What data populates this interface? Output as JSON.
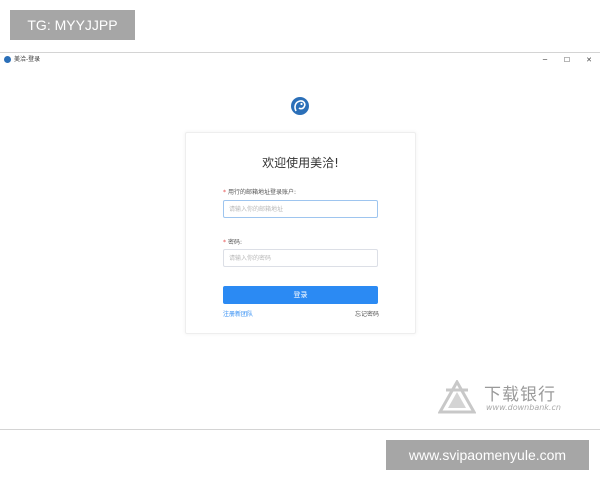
{
  "watermarks": {
    "top_text": "TG: MYYJJPP",
    "bottom_text": "www.svipaomenyule.com",
    "logo_text": "下载银行",
    "logo_url": "www.downbank.cn"
  },
  "window": {
    "title": "美洽-登录",
    "minimize_glyph": "─",
    "maximize_glyph": "☐",
    "close_glyph": "✕",
    "app_icon": "meiqia-logo-icon"
  },
  "login": {
    "welcome": "欢迎使用美洽!",
    "email_label": "用行的邮箱地址登录账户:",
    "email_placeholder": "请输入你的邮箱地址",
    "email_value": "",
    "password_label": "密码:",
    "password_placeholder": "请输入你的密码",
    "password_value": "",
    "required_mark": "*",
    "login_button": "登录",
    "register_link": "注册新团队",
    "forgot_link": "忘记密码"
  },
  "colors": {
    "accent": "#2b8af3",
    "logo_blue": "#2b6fb8",
    "required": "#e54d4d"
  }
}
